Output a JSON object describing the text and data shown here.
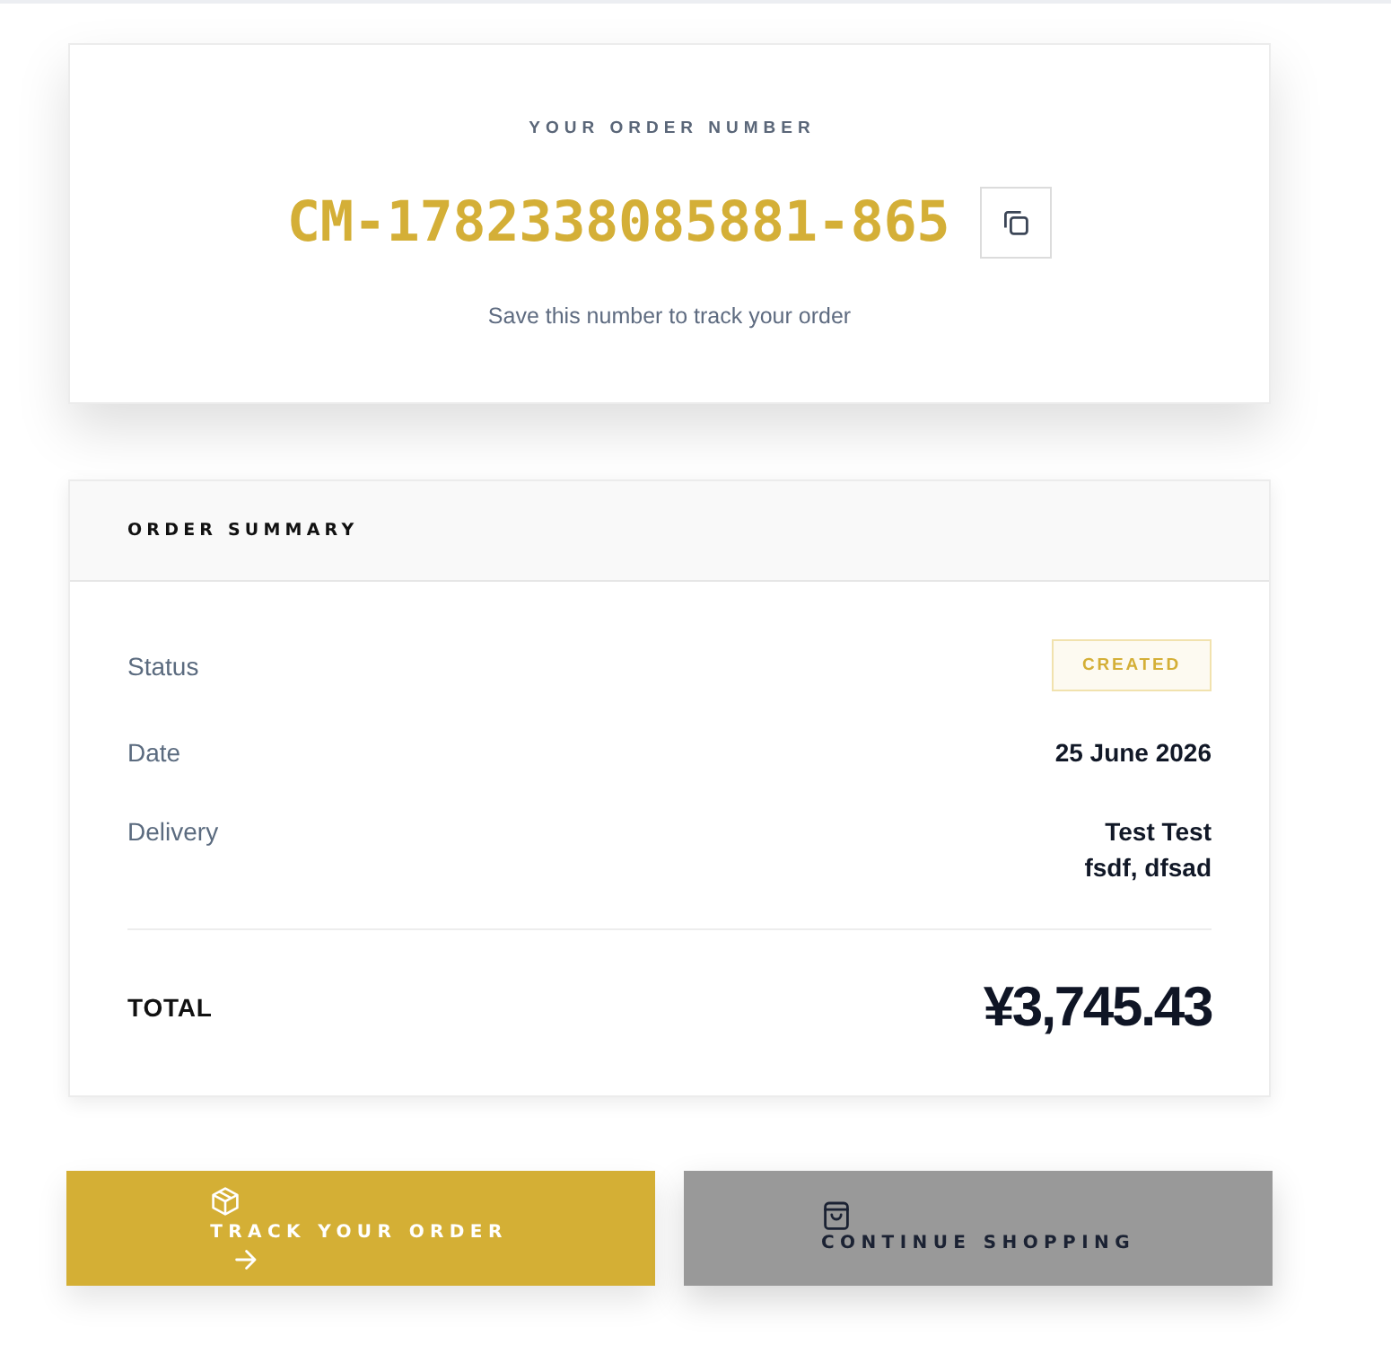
{
  "order_number_card": {
    "label": "YOUR ORDER NUMBER",
    "number": "CM-1782338085881-865",
    "hint": "Save this number to track your order"
  },
  "summary": {
    "title": "ORDER SUMMARY",
    "rows": [
      {
        "kind": "badge",
        "label": "Status",
        "value": "CREATED"
      },
      {
        "kind": "text",
        "label": "Date",
        "lines": [
          "25 June 2026"
        ]
      },
      {
        "kind": "text",
        "label": "Delivery",
        "lines": [
          "Test Test",
          "fsdf, dfsad"
        ]
      }
    ],
    "total_label": "TOTAL",
    "total": "¥3,745.43"
  },
  "actions": [
    {
      "kind": "primary",
      "label": "TRACK YOUR ORDER"
    },
    {
      "kind": "secondary",
      "label": "CONTINUE SHOPPING"
    }
  ]
}
